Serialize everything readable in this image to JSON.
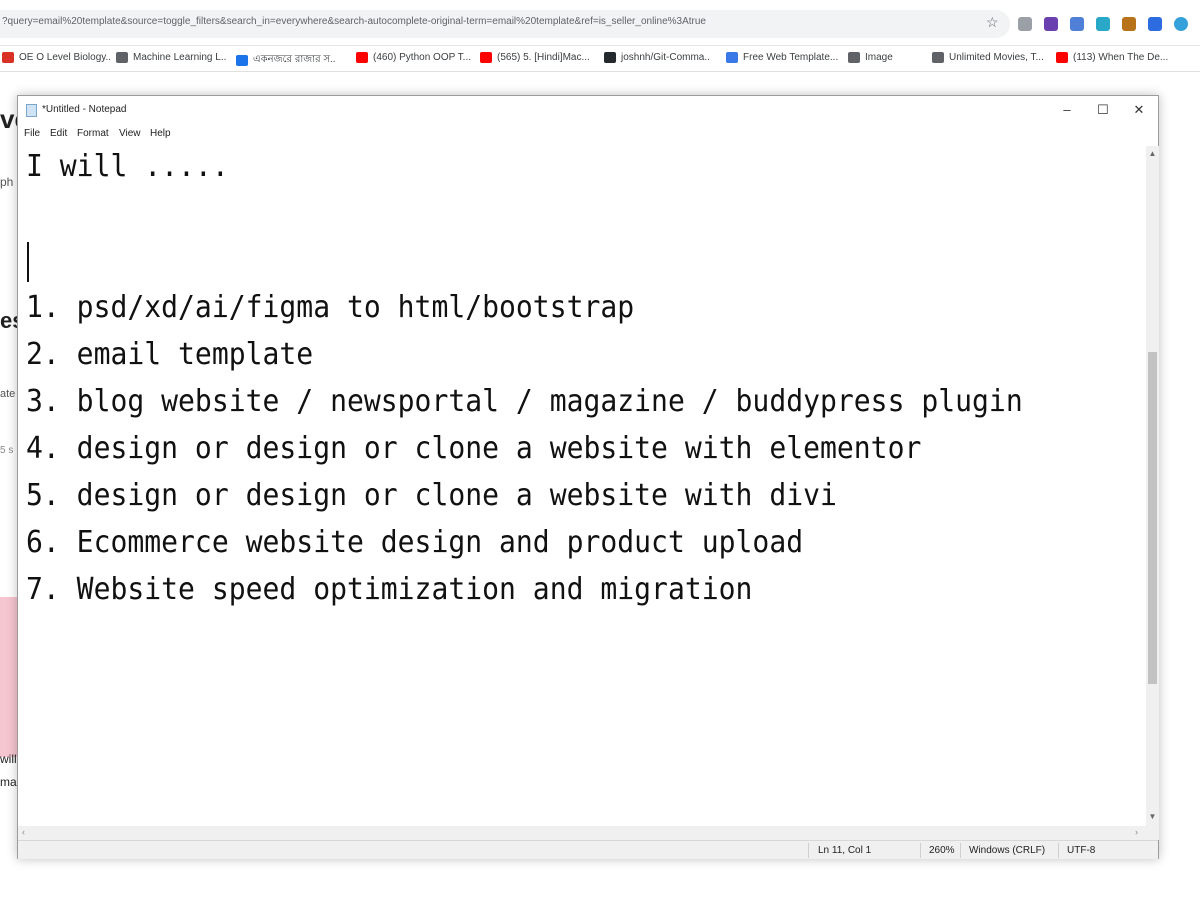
{
  "browser": {
    "url": "?query=email%20template&source=toggle_filters&search_in=everywhere&search-autocomplete-original-term=email%20template&ref=is_seller_online%3Atrue",
    "bookmarks": [
      {
        "label": "OE O Level Biology..",
        "color": "#d93025"
      },
      {
        "label": "Machine Learning L..",
        "color": "#5f6368"
      },
      {
        "label": "একনজরে রাজার স..",
        "color": "#1a73e8"
      },
      {
        "label": "(460) Python OOP T...",
        "color": "#ff0000"
      },
      {
        "label": "(565) 5. [Hindi]Mac...",
        "color": "#ff0000"
      },
      {
        "label": "joshnh/Git-Comma..",
        "color": "#24292e"
      },
      {
        "label": "Free Web Template...",
        "color": "#3b78e7"
      },
      {
        "label": "Image",
        "color": "#5f6368"
      },
      {
        "label": "Unlimited Movies, T...",
        "color": "#5f6368"
      },
      {
        "label": "(113) When The De...",
        "color": "#ff0000"
      }
    ]
  },
  "background": {
    "fragments": [
      "ve",
      "ph",
      "es",
      "ate",
      "5 s",
      "will",
      "ma"
    ]
  },
  "notepad": {
    "title": "*Untitled - Notepad",
    "menu": [
      "File",
      "Edit",
      "Format",
      "View",
      "Help"
    ],
    "window_controls": {
      "minimize": "–",
      "maximize": "☐",
      "close": "✕"
    },
    "lines": [
      "I will .....",
      "",
      "",
      "1. psd/xd/ai/figma to html/bootstrap",
      "2. email template",
      "3. blog website / newsportal / magazine / buddypress plugin",
      "4. design or design or clone a website with elementor",
      "5. design or design or clone a website with divi",
      "6. Ecommerce website design and product upload",
      "7. Website speed optimization and migration"
    ],
    "status": {
      "position": "Ln 11, Col 1",
      "zoom": "260%",
      "line_ending": "Windows (CRLF)",
      "encoding": "UTF-8"
    }
  },
  "icons": {
    "star": "bookmark-star-icon",
    "scroll_up": "▲",
    "scroll_down": "▼",
    "scroll_left": "‹",
    "scroll_right": "›"
  }
}
